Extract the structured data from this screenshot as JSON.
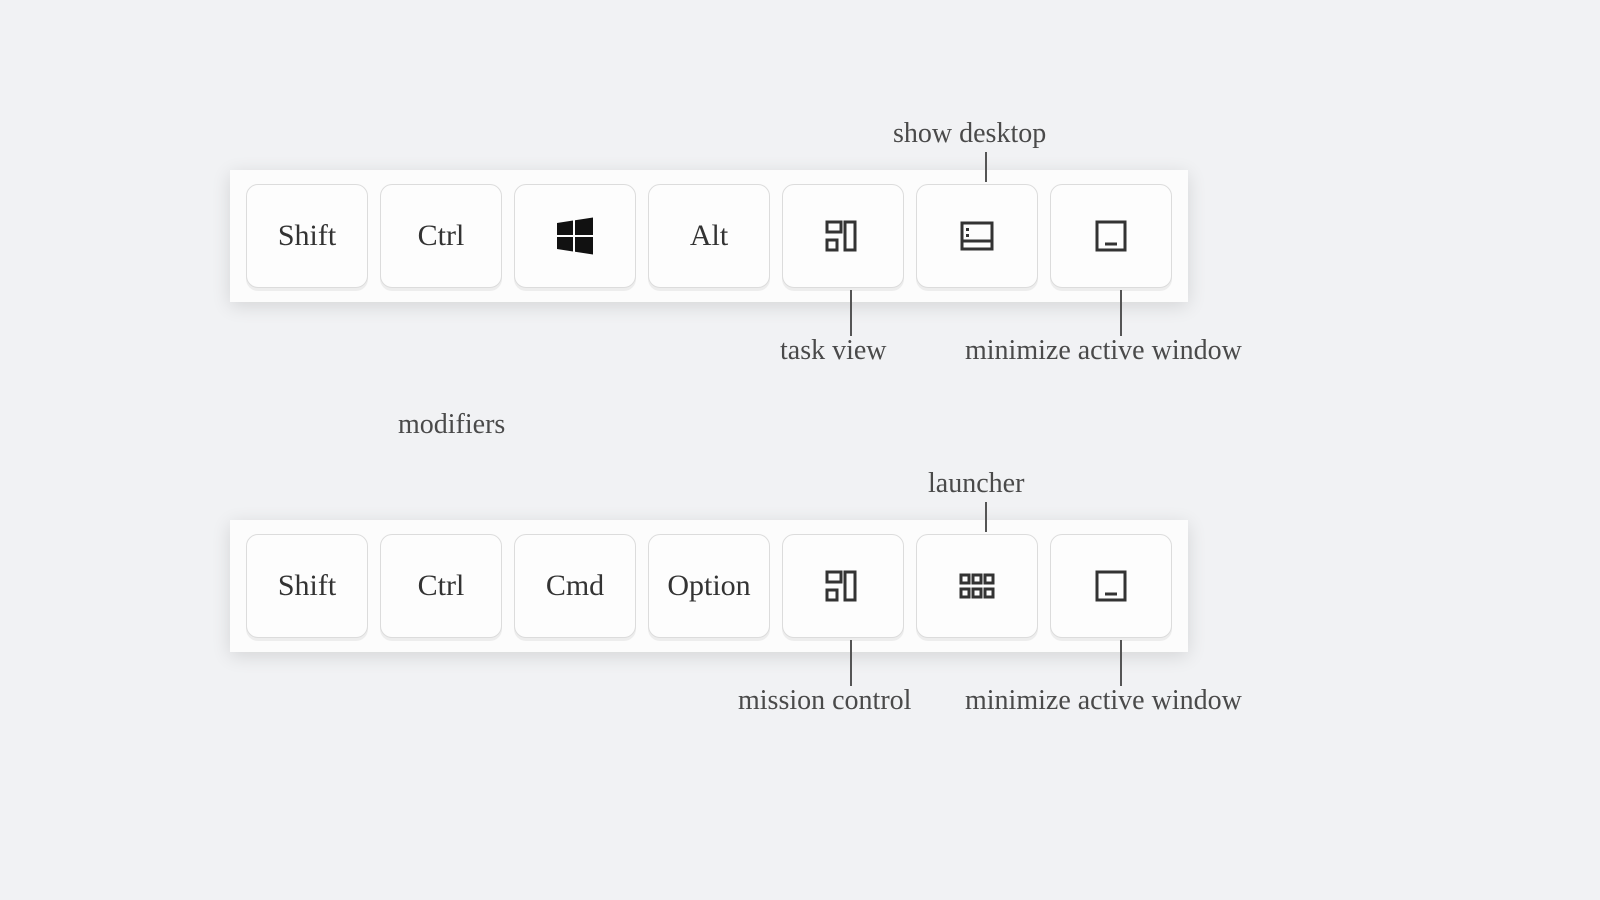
{
  "rows": [
    {
      "keys": [
        {
          "type": "text",
          "label": "Shift"
        },
        {
          "type": "text",
          "label": "Ctrl"
        },
        {
          "type": "icon",
          "icon": "windows"
        },
        {
          "type": "text",
          "label": "Alt"
        },
        {
          "type": "icon",
          "icon": "task-view"
        },
        {
          "type": "icon",
          "icon": "show-desktop"
        },
        {
          "type": "icon",
          "icon": "minimize"
        }
      ],
      "annotations": {
        "task_view": "task view",
        "show_desktop": "show desktop",
        "minimize": "minimize active window"
      }
    },
    {
      "keys": [
        {
          "type": "text",
          "label": "Shift"
        },
        {
          "type": "text",
          "label": "Ctrl"
        },
        {
          "type": "text",
          "label": "Cmd"
        },
        {
          "type": "text",
          "label": "Option"
        },
        {
          "type": "icon",
          "icon": "task-view"
        },
        {
          "type": "icon",
          "icon": "launcher"
        },
        {
          "type": "icon",
          "icon": "minimize"
        }
      ],
      "annotations": {
        "mission_control": "mission control",
        "launcher": "launcher",
        "minimize": "minimize active window"
      }
    }
  ],
  "labels": {
    "modifiers": "modifiers"
  }
}
